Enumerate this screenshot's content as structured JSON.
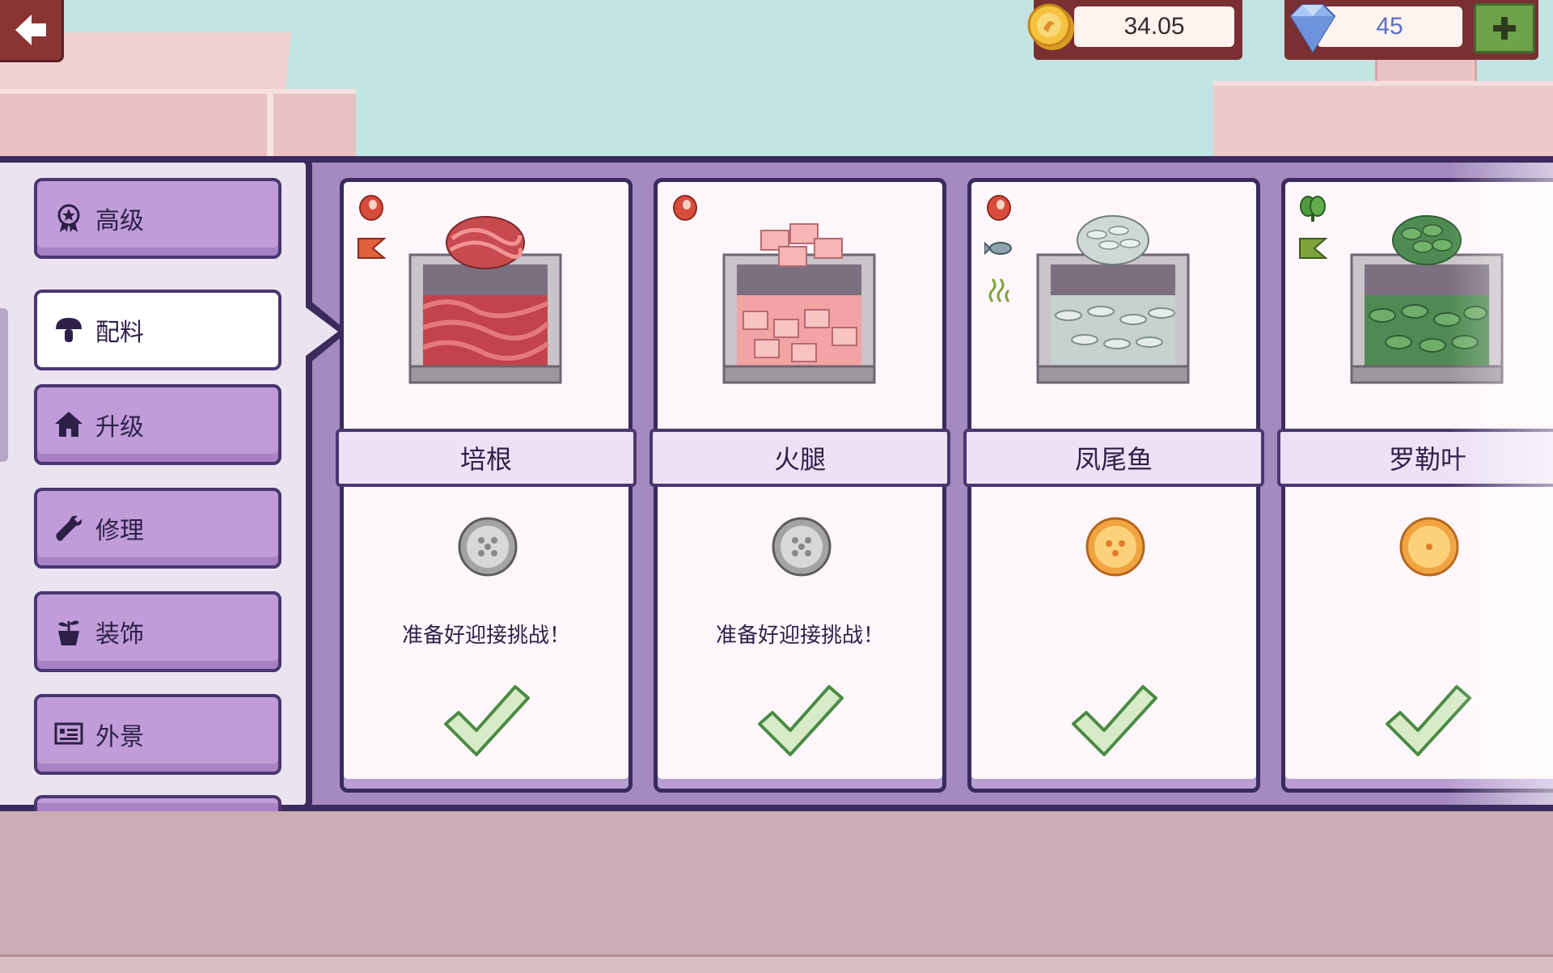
{
  "currency": {
    "coins": "34.05",
    "gems": "45"
  },
  "sidebar": {
    "items": [
      {
        "label": "高级",
        "icon": "ribbon-badge-icon",
        "active": false
      },
      {
        "label": "配料",
        "icon": "mushroom-icon",
        "active": true
      },
      {
        "label": "升级",
        "icon": "house-icon",
        "active": false
      },
      {
        "label": "修理",
        "icon": "wrench-icon",
        "active": false
      },
      {
        "label": "装饰",
        "icon": "potted-plant-icon",
        "active": false
      },
      {
        "label": "外景",
        "icon": "billboard-icon",
        "active": false
      }
    ]
  },
  "cards": [
    {
      "name": "培根",
      "food": "bacon",
      "tags": [
        "meat-icon",
        "flag-icon"
      ],
      "token": "grey",
      "message": "准备好迎接挑战！",
      "owned": true
    },
    {
      "name": "火腿",
      "food": "ham",
      "tags": [
        "meat-icon"
      ],
      "token": "grey",
      "message": "准备好迎接挑战！",
      "owned": true
    },
    {
      "name": "凤尾鱼",
      "food": "anchovy",
      "tags": [
        "meat-icon",
        "fish-icon",
        "smell-icon"
      ],
      "token": "orange-3",
      "message": "",
      "owned": true
    },
    {
      "name": "罗勒叶",
      "food": "basil",
      "tags": [
        "leaf-icon",
        "flag-icon"
      ],
      "token": "orange-1",
      "message": "",
      "owned": true
    }
  ],
  "colors": {
    "panel": "#a38bbf",
    "border": "#3b2a5c",
    "menu": "#c09dd8",
    "check": "#d8ebc8"
  }
}
